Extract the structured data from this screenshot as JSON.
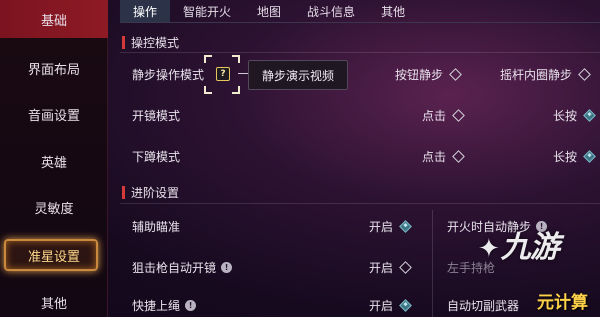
{
  "sidebar": {
    "items": [
      {
        "label": "基础"
      },
      {
        "label": "界面布局"
      },
      {
        "label": "音画设置"
      },
      {
        "label": "英雄"
      },
      {
        "label": "灵敏度"
      },
      {
        "label": "准星设置"
      },
      {
        "label": "其他"
      }
    ]
  },
  "tabs": [
    {
      "label": "操作"
    },
    {
      "label": "智能开火"
    },
    {
      "label": "地图"
    },
    {
      "label": "战斗信息"
    },
    {
      "label": "其他"
    }
  ],
  "sections": {
    "control_mode": "操控模式",
    "advanced": "进阶设置"
  },
  "control": {
    "quiet_step": {
      "label": "静步操作模式",
      "help": "?",
      "tooltip": "静步演示视频",
      "option_a": "按钮静步",
      "option_b": "摇杆内圈静步"
    },
    "scope": {
      "label": "开镜模式",
      "option_a": "点击",
      "option_b": "长按"
    },
    "crouch": {
      "label": "下蹲模式",
      "option_a": "点击",
      "option_b": "长按"
    }
  },
  "advanced": {
    "aim_assist": {
      "label": "辅助瞄准",
      "value": "开启"
    },
    "sniper_scope": {
      "label": "狙击枪自动开镜",
      "info": "!",
      "value": "开启"
    },
    "quick_rope": {
      "label": "快捷上绳",
      "info": "!",
      "value": "开启"
    },
    "fire_quiet_step": {
      "label": "开火时自动静步",
      "info": "!"
    },
    "hold_hold": {
      "label": "左手持枪"
    },
    "auto_switch": {
      "label": "自动切副武器"
    }
  },
  "watermark": {
    "logo": "九游",
    "sub": "元计算"
  },
  "colors": {
    "accent_red": "#8e1a24",
    "selected_gold": "#c9893e",
    "checked_teal": "#3d7684"
  }
}
